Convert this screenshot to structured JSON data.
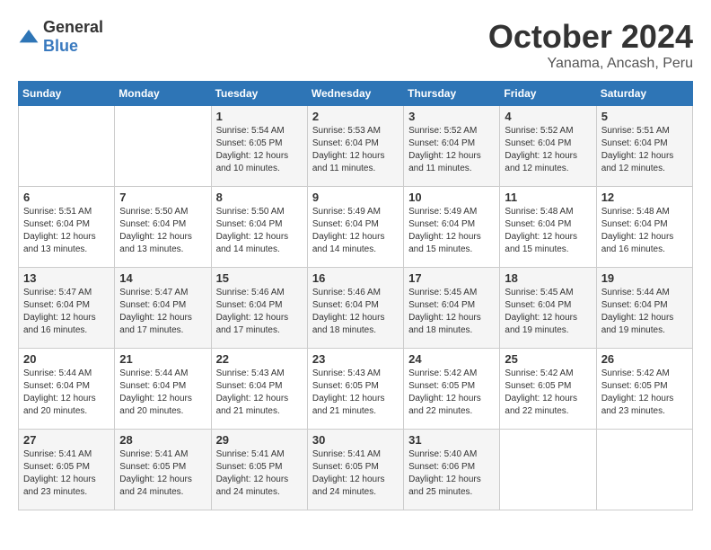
{
  "logo": {
    "general": "General",
    "blue": "Blue"
  },
  "title": "October 2024",
  "location": "Yanama, Ancash, Peru",
  "days_of_week": [
    "Sunday",
    "Monday",
    "Tuesday",
    "Wednesday",
    "Thursday",
    "Friday",
    "Saturday"
  ],
  "weeks": [
    [
      {
        "day": "",
        "sunrise": "",
        "sunset": "",
        "daylight": ""
      },
      {
        "day": "",
        "sunrise": "",
        "sunset": "",
        "daylight": ""
      },
      {
        "day": "1",
        "sunrise": "Sunrise: 5:54 AM",
        "sunset": "Sunset: 6:05 PM",
        "daylight": "Daylight: 12 hours and 10 minutes."
      },
      {
        "day": "2",
        "sunrise": "Sunrise: 5:53 AM",
        "sunset": "Sunset: 6:04 PM",
        "daylight": "Daylight: 12 hours and 11 minutes."
      },
      {
        "day": "3",
        "sunrise": "Sunrise: 5:52 AM",
        "sunset": "Sunset: 6:04 PM",
        "daylight": "Daylight: 12 hours and 11 minutes."
      },
      {
        "day": "4",
        "sunrise": "Sunrise: 5:52 AM",
        "sunset": "Sunset: 6:04 PM",
        "daylight": "Daylight: 12 hours and 12 minutes."
      },
      {
        "day": "5",
        "sunrise": "Sunrise: 5:51 AM",
        "sunset": "Sunset: 6:04 PM",
        "daylight": "Daylight: 12 hours and 12 minutes."
      }
    ],
    [
      {
        "day": "6",
        "sunrise": "Sunrise: 5:51 AM",
        "sunset": "Sunset: 6:04 PM",
        "daylight": "Daylight: 12 hours and 13 minutes."
      },
      {
        "day": "7",
        "sunrise": "Sunrise: 5:50 AM",
        "sunset": "Sunset: 6:04 PM",
        "daylight": "Daylight: 12 hours and 13 minutes."
      },
      {
        "day": "8",
        "sunrise": "Sunrise: 5:50 AM",
        "sunset": "Sunset: 6:04 PM",
        "daylight": "Daylight: 12 hours and 14 minutes."
      },
      {
        "day": "9",
        "sunrise": "Sunrise: 5:49 AM",
        "sunset": "Sunset: 6:04 PM",
        "daylight": "Daylight: 12 hours and 14 minutes."
      },
      {
        "day": "10",
        "sunrise": "Sunrise: 5:49 AM",
        "sunset": "Sunset: 6:04 PM",
        "daylight": "Daylight: 12 hours and 15 minutes."
      },
      {
        "day": "11",
        "sunrise": "Sunrise: 5:48 AM",
        "sunset": "Sunset: 6:04 PM",
        "daylight": "Daylight: 12 hours and 15 minutes."
      },
      {
        "day": "12",
        "sunrise": "Sunrise: 5:48 AM",
        "sunset": "Sunset: 6:04 PM",
        "daylight": "Daylight: 12 hours and 16 minutes."
      }
    ],
    [
      {
        "day": "13",
        "sunrise": "Sunrise: 5:47 AM",
        "sunset": "Sunset: 6:04 PM",
        "daylight": "Daylight: 12 hours and 16 minutes."
      },
      {
        "day": "14",
        "sunrise": "Sunrise: 5:47 AM",
        "sunset": "Sunset: 6:04 PM",
        "daylight": "Daylight: 12 hours and 17 minutes."
      },
      {
        "day": "15",
        "sunrise": "Sunrise: 5:46 AM",
        "sunset": "Sunset: 6:04 PM",
        "daylight": "Daylight: 12 hours and 17 minutes."
      },
      {
        "day": "16",
        "sunrise": "Sunrise: 5:46 AM",
        "sunset": "Sunset: 6:04 PM",
        "daylight": "Daylight: 12 hours and 18 minutes."
      },
      {
        "day": "17",
        "sunrise": "Sunrise: 5:45 AM",
        "sunset": "Sunset: 6:04 PM",
        "daylight": "Daylight: 12 hours and 18 minutes."
      },
      {
        "day": "18",
        "sunrise": "Sunrise: 5:45 AM",
        "sunset": "Sunset: 6:04 PM",
        "daylight": "Daylight: 12 hours and 19 minutes."
      },
      {
        "day": "19",
        "sunrise": "Sunrise: 5:44 AM",
        "sunset": "Sunset: 6:04 PM",
        "daylight": "Daylight: 12 hours and 19 minutes."
      }
    ],
    [
      {
        "day": "20",
        "sunrise": "Sunrise: 5:44 AM",
        "sunset": "Sunset: 6:04 PM",
        "daylight": "Daylight: 12 hours and 20 minutes."
      },
      {
        "day": "21",
        "sunrise": "Sunrise: 5:44 AM",
        "sunset": "Sunset: 6:04 PM",
        "daylight": "Daylight: 12 hours and 20 minutes."
      },
      {
        "day": "22",
        "sunrise": "Sunrise: 5:43 AM",
        "sunset": "Sunset: 6:04 PM",
        "daylight": "Daylight: 12 hours and 21 minutes."
      },
      {
        "day": "23",
        "sunrise": "Sunrise: 5:43 AM",
        "sunset": "Sunset: 6:05 PM",
        "daylight": "Daylight: 12 hours and 21 minutes."
      },
      {
        "day": "24",
        "sunrise": "Sunrise: 5:42 AM",
        "sunset": "Sunset: 6:05 PM",
        "daylight": "Daylight: 12 hours and 22 minutes."
      },
      {
        "day": "25",
        "sunrise": "Sunrise: 5:42 AM",
        "sunset": "Sunset: 6:05 PM",
        "daylight": "Daylight: 12 hours and 22 minutes."
      },
      {
        "day": "26",
        "sunrise": "Sunrise: 5:42 AM",
        "sunset": "Sunset: 6:05 PM",
        "daylight": "Daylight: 12 hours and 23 minutes."
      }
    ],
    [
      {
        "day": "27",
        "sunrise": "Sunrise: 5:41 AM",
        "sunset": "Sunset: 6:05 PM",
        "daylight": "Daylight: 12 hours and 23 minutes."
      },
      {
        "day": "28",
        "sunrise": "Sunrise: 5:41 AM",
        "sunset": "Sunset: 6:05 PM",
        "daylight": "Daylight: 12 hours and 24 minutes."
      },
      {
        "day": "29",
        "sunrise": "Sunrise: 5:41 AM",
        "sunset": "Sunset: 6:05 PM",
        "daylight": "Daylight: 12 hours and 24 minutes."
      },
      {
        "day": "30",
        "sunrise": "Sunrise: 5:41 AM",
        "sunset": "Sunset: 6:05 PM",
        "daylight": "Daylight: 12 hours and 24 minutes."
      },
      {
        "day": "31",
        "sunrise": "Sunrise: 5:40 AM",
        "sunset": "Sunset: 6:06 PM",
        "daylight": "Daylight: 12 hours and 25 minutes."
      },
      {
        "day": "",
        "sunrise": "",
        "sunset": "",
        "daylight": ""
      },
      {
        "day": "",
        "sunrise": "",
        "sunset": "",
        "daylight": ""
      }
    ]
  ]
}
